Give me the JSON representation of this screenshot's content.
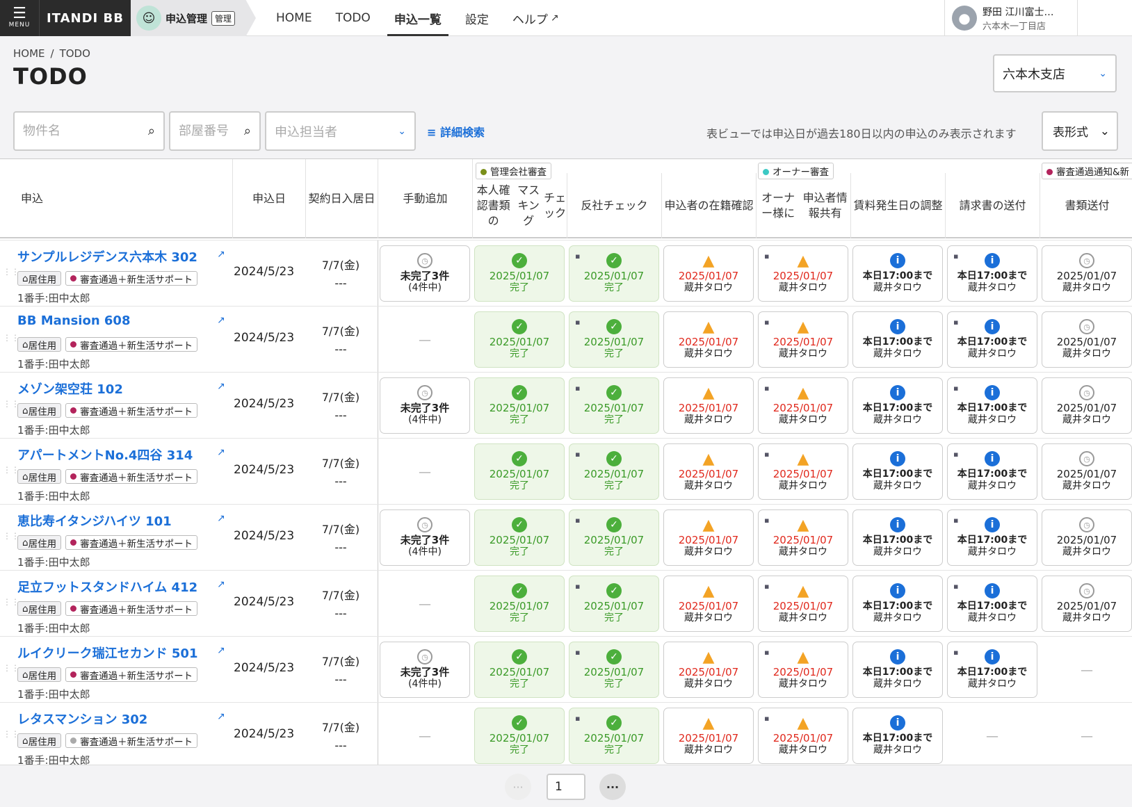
{
  "header": {
    "menu_label": "MENU",
    "logo": "ITANDI BB",
    "app_name": "申込管理",
    "admin_badge": "管理",
    "nav": [
      "HOME",
      "TODO",
      "申込一覧",
      "設定",
      "ヘルプ"
    ],
    "user_name": "野田 江川富士…",
    "user_store": "六本木一丁目店"
  },
  "breadcrumb": {
    "home": "HOME",
    "sep": "/",
    "current": "TODO"
  },
  "page_title": "TODO",
  "branch_select": "六本木支店",
  "filters": {
    "property_placeholder": "物件名",
    "room_placeholder": "部屋番号",
    "assignee_placeholder": "申込担当者",
    "advanced": "詳細検索",
    "note": "表ビューでは申込日が過去180日以内の申込のみ表示されます",
    "view_mode": "表形式"
  },
  "columns": {
    "app": "申込",
    "app_date": "申込日",
    "contract": "契約日",
    "movein": "入居日",
    "manual": "手動追加",
    "id_mask": [
      "本人確認書類の",
      "マスキング",
      "チェック"
    ],
    "antisocial": "反社チェック",
    "employ": [
      "申込者の",
      "在籍確認"
    ],
    "owner_share": [
      "オーナー様に",
      "申込者情報共有"
    ],
    "rent_start": [
      "賃料発生日の",
      "調整"
    ],
    "invoice": "請求書の送付",
    "docs": "書類送付"
  },
  "groups": {
    "mgmt": "管理会社審査",
    "owner": "オーナー審査",
    "notice": "審査通過通知&新"
  },
  "colors": {
    "accent": "#1b6fd8",
    "mgmt_dot": "#7a8f1a",
    "owner_dot": "#3cc9c4",
    "notice_dot": "#b3245c",
    "tag_dot": "#b3245c",
    "tag_dot_gray": "#aaaaaa"
  },
  "labels": {
    "residence": "居住用",
    "status_tag": "審査通過＋新生活サポート",
    "holder": "1番手:田中太郎",
    "app_date": "2024/5/23",
    "contract_date": "7/7(金)",
    "movein": "---",
    "pending": "未完了3件",
    "pending_sub": "(4件中)",
    "date": "2025/01/07",
    "done": "完了",
    "person": "蔵井タロウ",
    "deadline": "本日17:00まで",
    "dash": "—"
  },
  "rows": [
    {
      "name": "サンプルレジデンス六本木 302",
      "manual": true,
      "invoice": true,
      "docs": true,
      "rent": true,
      "tagGray": false
    },
    {
      "name": "BB Mansion 608",
      "manual": false,
      "invoice": true,
      "docs": true,
      "rent": true,
      "tagGray": false
    },
    {
      "name": "メゾン架空荘 102",
      "manual": true,
      "invoice": true,
      "docs": true,
      "rent": true,
      "tagGray": false
    },
    {
      "name": "アパートメントNo.4四谷 314",
      "manual": false,
      "invoice": true,
      "docs": true,
      "rent": true,
      "tagGray": false
    },
    {
      "name": "恵比寿イタンジハイツ 101",
      "manual": true,
      "invoice": true,
      "docs": true,
      "rent": true,
      "tagGray": false
    },
    {
      "name": "足立フットスタンドハイム 412",
      "manual": false,
      "invoice": true,
      "docs": true,
      "rent": true,
      "tagGray": false
    },
    {
      "name": "ルイクリーク瑞江セカンド 501",
      "manual": true,
      "invoice": true,
      "docs": false,
      "rent": true,
      "tagGray": false
    },
    {
      "name": "レタスマンション 302",
      "manual": false,
      "invoice": false,
      "docs": false,
      "rent": true,
      "tagGray": true
    }
  ],
  "pager": {
    "current": "1",
    "more": "···"
  }
}
